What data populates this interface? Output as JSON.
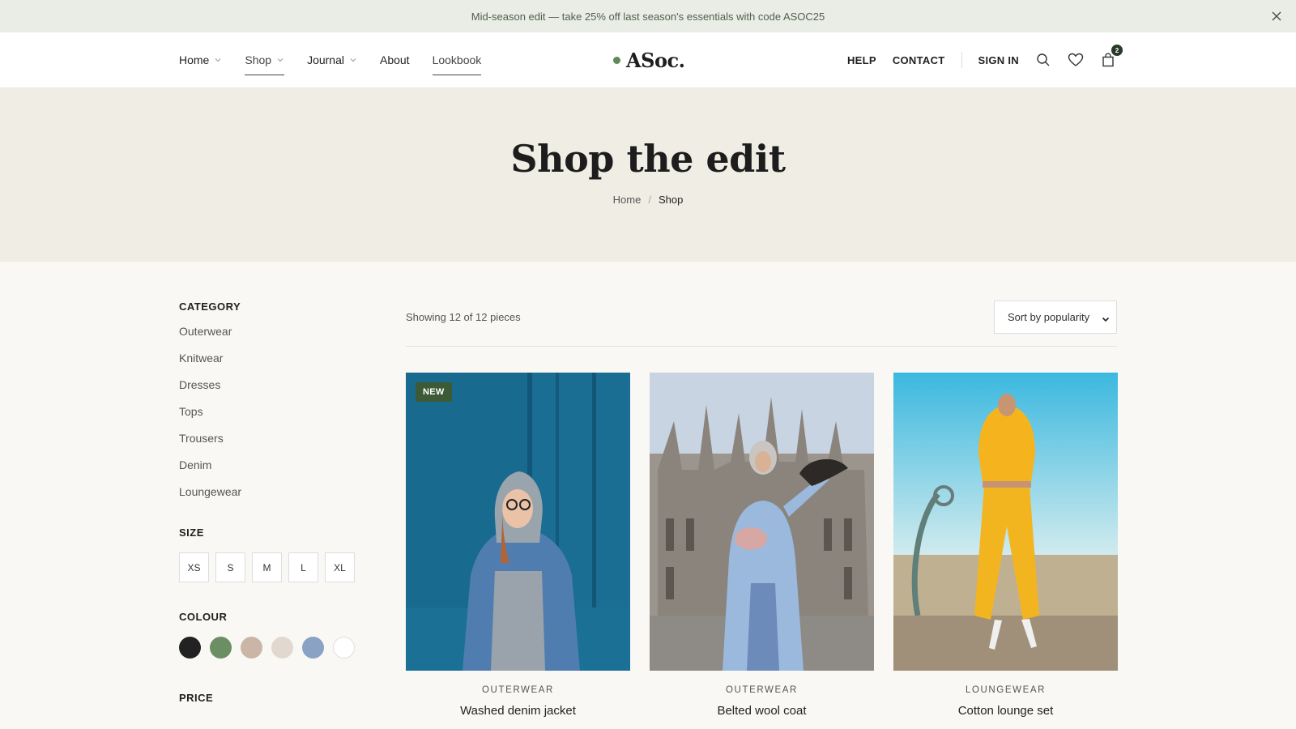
{
  "announcement": {
    "text": "Mid-season edit — take 25% off last season's essentials with code ASOC25",
    "close_icon": "close-icon"
  },
  "header": {
    "nav": [
      {
        "label": "Home",
        "has_dropdown": true
      },
      {
        "label": "Shop",
        "has_dropdown": true,
        "active": true
      },
      {
        "label": "Journal",
        "has_dropdown": true
      },
      {
        "label": "About",
        "has_dropdown": false
      },
      {
        "label": "Lookbook",
        "has_dropdown": false
      }
    ],
    "logo": "ASoc.",
    "right_links": {
      "help": "HELP",
      "contact": "CONTACT",
      "sign_in": "SIGN IN"
    },
    "icons": [
      "search-icon",
      "heart-icon",
      "bag-icon"
    ],
    "cart_count": "2"
  },
  "hero": {
    "title": "Shop the edit",
    "breadcrumb": {
      "home": "Home",
      "separator": "/",
      "current": "Shop"
    }
  },
  "filters": {
    "category": {
      "heading": "CATEGORY",
      "items": [
        "Outerwear",
        "Knitwear",
        "Dresses",
        "Tops",
        "Trousers",
        "Denim",
        "Loungewear"
      ]
    },
    "size": {
      "heading": "SIZE",
      "options": [
        "XS",
        "S",
        "M",
        "L",
        "XL"
      ]
    },
    "colour": {
      "heading": "COLOUR",
      "swatches": [
        "#222222",
        "#6b8f63",
        "#cbb5a6",
        "#e1d9cf",
        "#8aa2c4",
        "#ffffff"
      ]
    },
    "price": {
      "heading": "PRICE"
    }
  },
  "listing": {
    "results_text": "Showing 12 of 12 pieces",
    "sort_selected": "Sort by popularity"
  },
  "products": [
    {
      "category": "OUTERWEAR",
      "name": "Washed denim jacket",
      "badge": "NEW"
    },
    {
      "category": "OUTERWEAR",
      "name": "Belted wool coat",
      "badge": ""
    },
    {
      "category": "LOUNGEWEAR",
      "name": "Cotton lounge set",
      "badge": ""
    }
  ],
  "colors": {
    "accent_green": "#3d5a37",
    "hero_bg": "#efede4",
    "announce_bg": "#e9ede6"
  }
}
